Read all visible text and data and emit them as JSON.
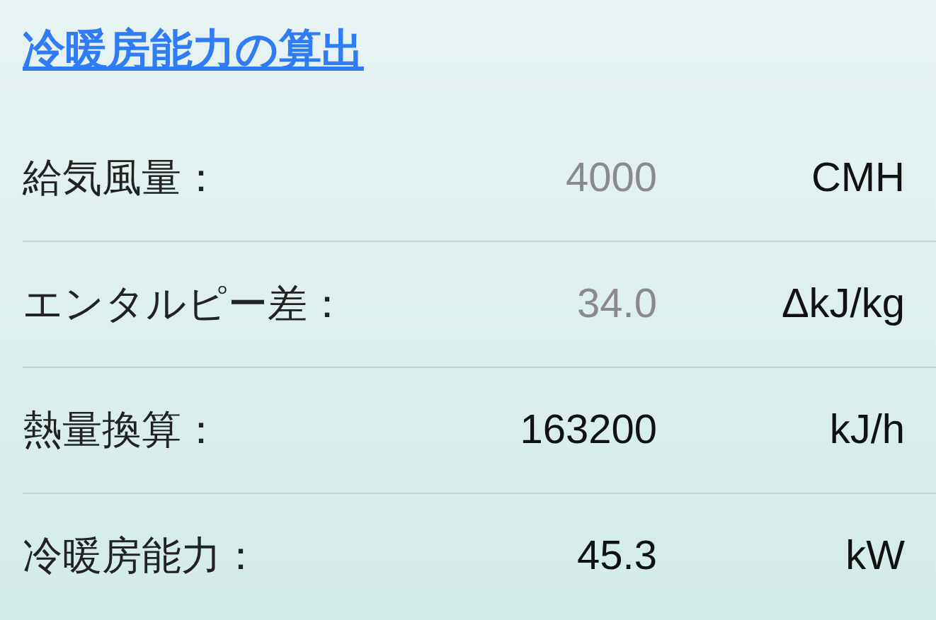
{
  "title": "冷暖房能力の算出",
  "rows": [
    {
      "kind": "input",
      "label": "給気風量：",
      "placeholder": "4000",
      "unit": "CMH"
    },
    {
      "kind": "input",
      "label": "エンタルピー差：",
      "placeholder": "34.0",
      "unit": "ΔkJ/kg"
    },
    {
      "kind": "output",
      "label": "熱量換算：",
      "value": "163200",
      "unit": "kJ/h"
    },
    {
      "kind": "output",
      "label": "冷暖房能力：",
      "value": "45.3",
      "unit": "kW"
    }
  ]
}
